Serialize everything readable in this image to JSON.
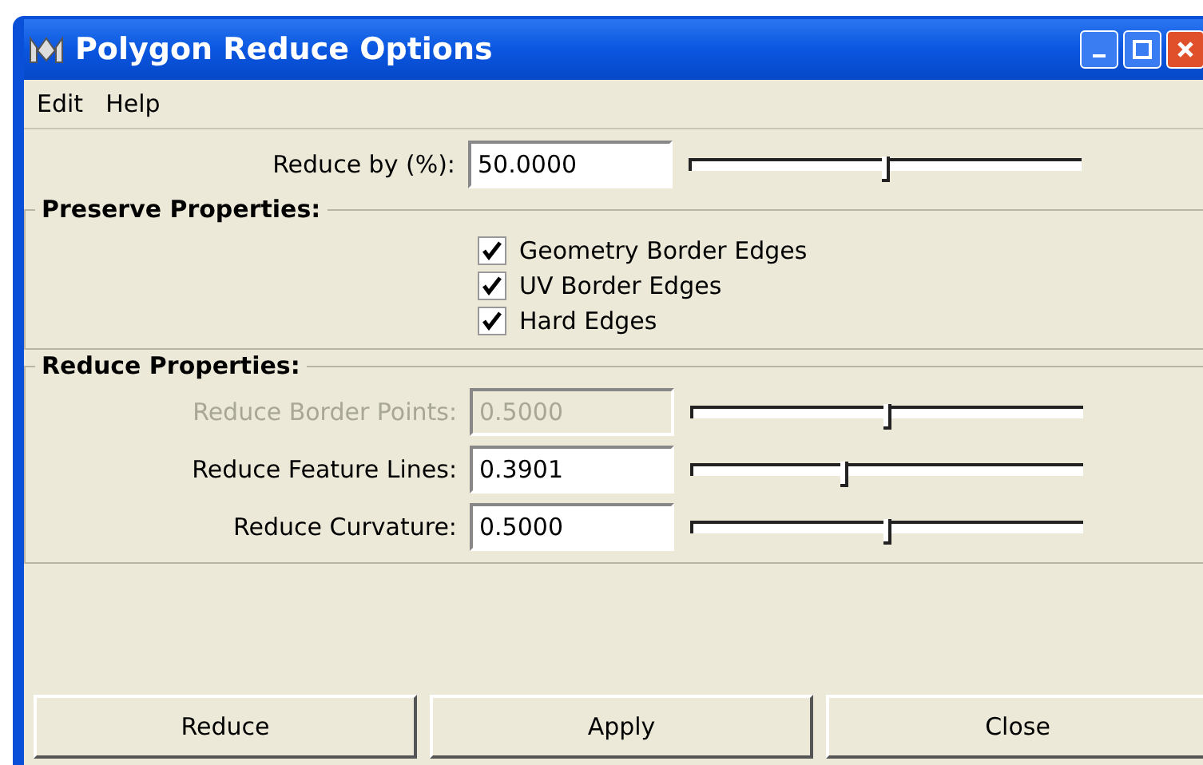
{
  "window": {
    "title": "Polygon Reduce Options"
  },
  "menu": [
    "Edit",
    "Help"
  ],
  "reduce_by": {
    "label": "Reduce by (%):",
    "value": "50.0000",
    "level": 0.5
  },
  "preserve": {
    "title": "Preserve Properties:",
    "options": [
      {
        "label": "Geometry Border Edges",
        "checked": true
      },
      {
        "label": "UV Border Edges",
        "checked": true
      },
      {
        "label": "Hard Edges",
        "checked": true
      }
    ]
  },
  "reduce": {
    "title": "Reduce Properties:",
    "fields": [
      {
        "label": "Reduce Border Points:",
        "value": "0.5000",
        "level": 0.5,
        "disabled": true
      },
      {
        "label": "Reduce Feature Lines:",
        "value": "0.3901",
        "level": 0.39,
        "disabled": false
      },
      {
        "label": "Reduce Curvature:",
        "value": "0.5000",
        "level": 0.5,
        "disabled": false
      }
    ]
  },
  "buttons": [
    "Reduce",
    "Apply",
    "Close"
  ]
}
